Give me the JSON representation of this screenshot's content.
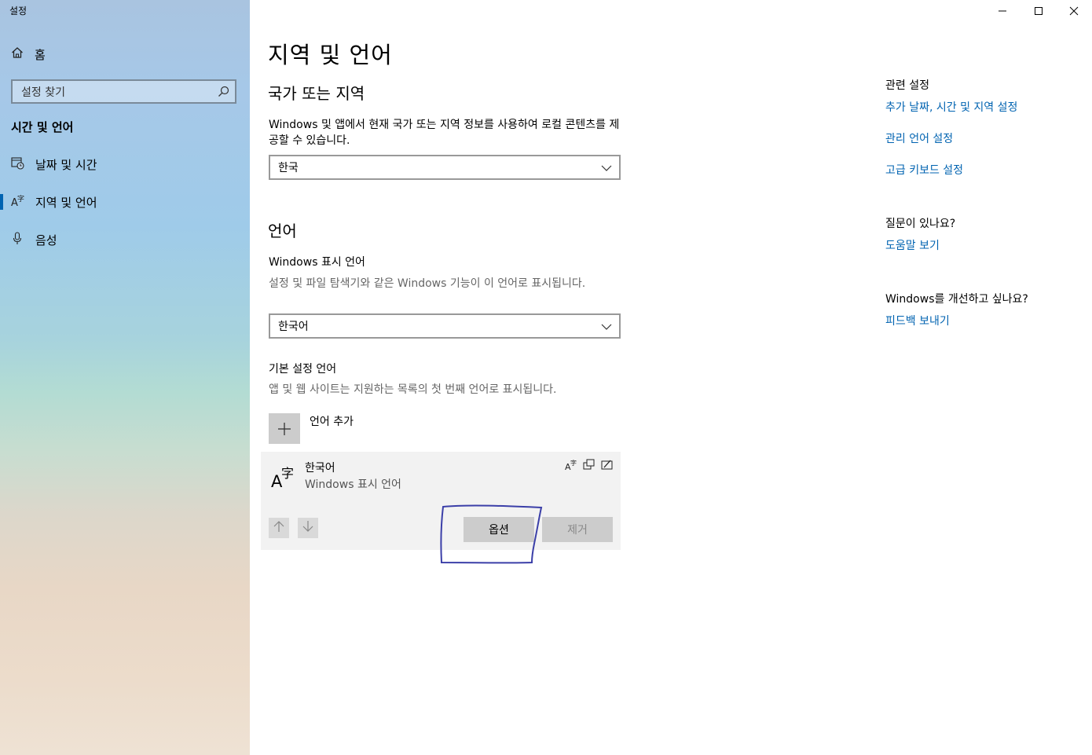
{
  "window": {
    "title": "설정"
  },
  "sidebar": {
    "home_label": "홈",
    "search_placeholder": "설정 찾기",
    "section_title": "시간 및 언어",
    "items": [
      {
        "label": "날짜 및 시간",
        "icon": "calendar-clock-icon"
      },
      {
        "label": "지역 및 언어",
        "icon": "language-icon",
        "active": true
      },
      {
        "label": "음성",
        "icon": "microphone-icon"
      }
    ]
  },
  "main": {
    "page_title": "지역 및 언어",
    "region": {
      "heading": "국가 또는 지역",
      "description": "Windows 및 앱에서 현재 국가 또는 지역 정보를 사용하여 로컬 콘텐츠를 제공할 수 있습니다.",
      "selected": "한국"
    },
    "language": {
      "heading": "언어",
      "display_label": "Windows 표시 언어",
      "display_desc": "설정 및 파일 탐색기와 같은 Windows 기능이 이 언어로 표시됩니다.",
      "display_selected": "한국어",
      "preferred_label": "기본 설정 언어",
      "preferred_desc": "앱 및 웹 사이트는 지원하는 목록의 첫 번째 언어로 표시됩니다.",
      "add_label": "언어 추가",
      "card": {
        "name": "한국어",
        "sub": "Windows 표시 언어",
        "options_label": "옵션",
        "remove_label": "제거"
      }
    }
  },
  "right_panel": {
    "related_heading": "관련 설정",
    "links": [
      "추가 날짜, 시간 및 지역 설정",
      "관리 언어 설정",
      "고급 키보드 설정"
    ],
    "question_heading": "질문이 있나요?",
    "help_link": "도움말 보기",
    "improve_heading": "Windows를 개선하고 싶나요?",
    "feedback_link": "피드백 보내기"
  },
  "colors": {
    "accent": "#0063b1",
    "annotation": "#3b3fa8"
  }
}
